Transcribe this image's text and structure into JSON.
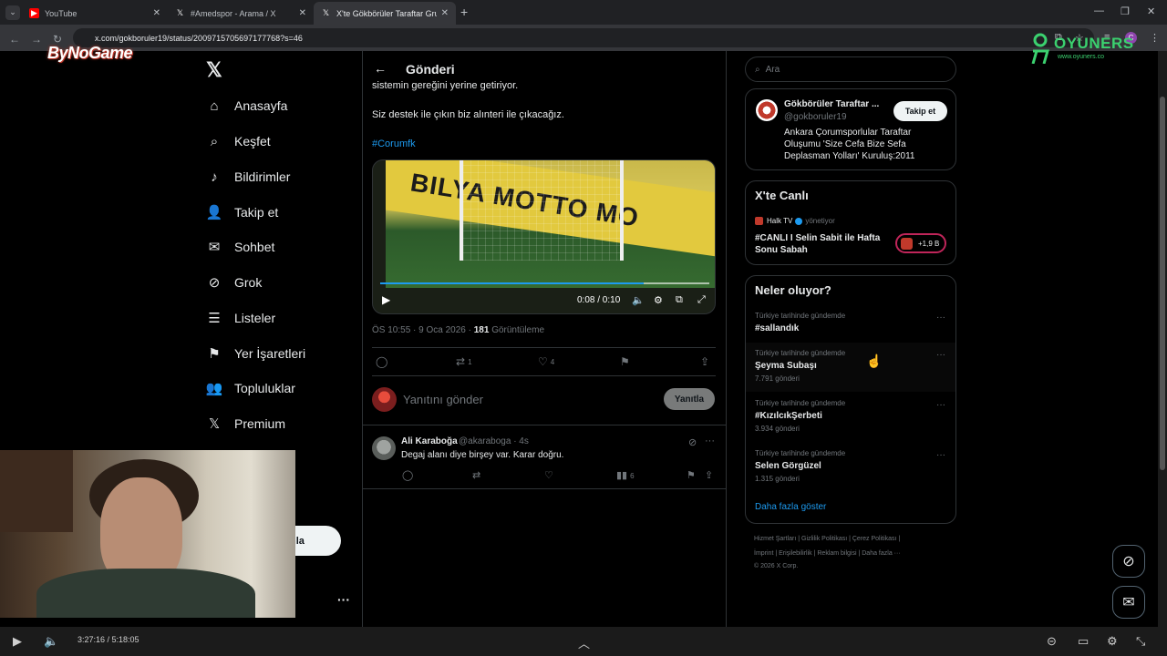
{
  "browser": {
    "tabs": [
      {
        "title": "YouTube",
        "favicon": "youtube-icon"
      },
      {
        "title": "#Amedspor - Arama / X",
        "favicon": "x-icon"
      },
      {
        "title": "X'te Gökbörüler Taraftar Grubu",
        "favicon": "x-icon"
      }
    ],
    "url": "x.com/gokboruler19/status/2009715705697177768?s=46",
    "profile_initial": "C"
  },
  "overlay": {
    "stream_logo": "ByNoGame",
    "brand_word": "OYUNERS",
    "brand_site": "www.oyuners.co"
  },
  "nav": {
    "items": [
      {
        "label": "Anasayfa",
        "icon": "home-icon"
      },
      {
        "label": "Keşfet",
        "icon": "search-icon"
      },
      {
        "label": "Bildirimler",
        "icon": "bell-icon"
      },
      {
        "label": "Takip et",
        "icon": "person-add-icon"
      },
      {
        "label": "Sohbet",
        "icon": "mail-icon"
      },
      {
        "label": "Grok",
        "icon": "grok-icon"
      },
      {
        "label": "Listeler",
        "icon": "list-icon"
      },
      {
        "label": "Yer İşaretleri",
        "icon": "bookmark-icon"
      },
      {
        "label": "Topluluklar",
        "icon": "communities-icon"
      },
      {
        "label": "Premium",
        "icon": "x-icon"
      }
    ],
    "post_button_fragment": "nla"
  },
  "post": {
    "header_title": "Gönderi",
    "text_line_1": "sistemin gereğini yerine getiriyor.",
    "text_line_2": "Siz destek ile çıkın biz alınteri ile çıkacağız.",
    "hashtag": "#Corumfk",
    "video": {
      "board_text": "BILYA MOTTO MO",
      "time": "0:08 / 0:10",
      "progress": 0.8
    },
    "meta_time": "ÖS 10:55 · 9 Oca 2026 · ",
    "views": "181",
    "views_label": " Görüntüleme",
    "retweets": "1",
    "likes": "4"
  },
  "reply_box": {
    "placeholder": "Yanıtını gönder",
    "button": "Yanıtla"
  },
  "reply": {
    "name": "Ali Karaboğa",
    "handle": "@akaraboga · 4s",
    "text": "Degaj alanı diye birşey var. Karar doğru.",
    "views": "6"
  },
  "sidebar": {
    "search_placeholder": "Ara",
    "profile": {
      "name": "Gökbörüler Taraftar ...",
      "handle": "@gokboruler19",
      "follow": "Takip et",
      "bio": "Ankara Çorumsporlular Taraftar Oluşumu 'Size Cefa Bize Sefa Deplasman Yolları' Kuruluş:2011"
    },
    "live": {
      "title": "X'te Canlı",
      "channel": "Halk TV",
      "managing": "yönetiyor",
      "broadcast": "#CANLI I Selin Sabit ile Hafta Sonu Sabah",
      "listeners": "+1,9 B"
    },
    "trends": {
      "title": "Neler oluyor?",
      "items": [
        {
          "context": "Türkiye tarihinde gündemde",
          "name": "#sallandık",
          "count": ""
        },
        {
          "context": "Türkiye tarihinde gündemde",
          "name": "Şeyma Subaşı",
          "count": "7.791 gönderi"
        },
        {
          "context": "Türkiye tarihinde gündemde",
          "name": "#KızılcıkŞerbeti",
          "count": "3.934 gönderi"
        },
        {
          "context": "Türkiye tarihinde gündemde",
          "name": "Selen Görgüzel",
          "count": "1.315 gönderi"
        }
      ],
      "show_more": "Daha fazla göster"
    },
    "footer": {
      "line1": "Hizmet Şartları  |  Gizlilik Politikası  |  Çerez Politikası  |",
      "line2": "İmprint  |  Erişilebilirlik  |  Reklam bilgisi  |  Daha fazla ···",
      "line3": "© 2026 X Corp."
    }
  },
  "player": {
    "time": "3:27:16 / 5:18:05"
  }
}
